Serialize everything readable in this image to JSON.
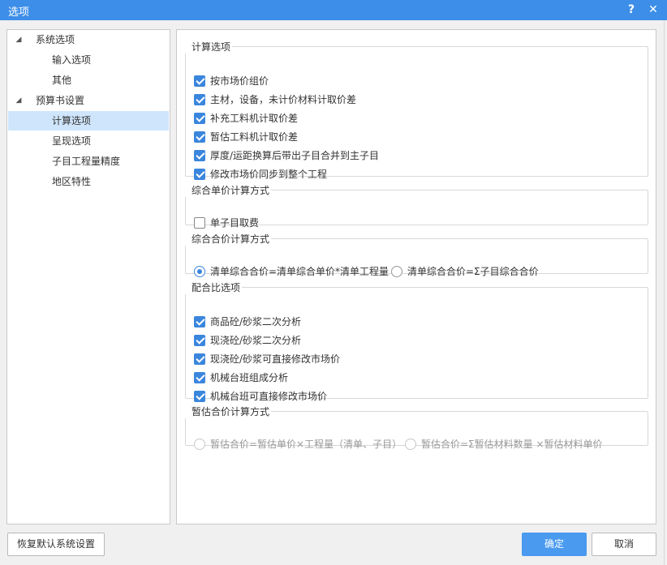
{
  "window": {
    "title": "选项",
    "help_glyph": "?",
    "close_glyph": "✕"
  },
  "tree": {
    "items": [
      {
        "label": "系统选项",
        "level": 1,
        "expanded": true
      },
      {
        "label": "输入选项",
        "level": 2
      },
      {
        "label": "其他",
        "level": 2
      },
      {
        "label": "预算书设置",
        "level": 1,
        "expanded": true
      },
      {
        "label": "计算选项",
        "level": 2,
        "selected": true
      },
      {
        "label": "呈现选项",
        "level": 2
      },
      {
        "label": "子目工程量精度",
        "level": 2
      },
      {
        "label": "地区特性",
        "level": 2
      }
    ],
    "expanded_glyph": "◢"
  },
  "groups": {
    "calc": {
      "title": "计算选项",
      "options": [
        {
          "label": "按市场价组价",
          "checked": true
        },
        {
          "label": "主材，设备，未计价材料计取价差",
          "checked": true
        },
        {
          "label": "补充工料机计取价差",
          "checked": true
        },
        {
          "label": "暂估工料机计取价差",
          "checked": true
        },
        {
          "label": "厚度/运距换算后带出子目合并到主子目",
          "checked": true
        },
        {
          "label": "修改市场价同步到整个工程",
          "checked": true
        }
      ]
    },
    "unit_price": {
      "title": "综合单价计算方式",
      "options": [
        {
          "label": "单子目取费",
          "checked": false
        }
      ]
    },
    "total_price": {
      "title": "综合合价计算方式",
      "radios": [
        {
          "label": "清单综合合价=清单综合单价*清单工程量",
          "selected": true
        },
        {
          "label": "清单综合合价=Σ子目综合合价",
          "selected": false
        }
      ]
    },
    "mix": {
      "title": "配合比选项",
      "options": [
        {
          "label": "商品砼/砂浆二次分析",
          "checked": true
        },
        {
          "label": "现浇砼/砂浆二次分析",
          "checked": true
        },
        {
          "label": "现浇砼/砂浆可直接修改市场价",
          "checked": true
        },
        {
          "label": "机械台班组成分析",
          "checked": true
        },
        {
          "label": "机械台班可直接修改市场价",
          "checked": true
        }
      ]
    },
    "provisional": {
      "title": "暂估合价计算方式",
      "disabled": true,
      "radios": [
        {
          "label": "暂估合价=暂估单价×工程量（清单、子目）",
          "selected": false
        },
        {
          "label": "暂估合价=Σ暂估材料数量 ×暂估材料单价",
          "selected": false
        }
      ]
    }
  },
  "buttons": {
    "restore": "恢复默认系统设置",
    "ok": "确定",
    "cancel": "取消"
  },
  "colors": {
    "titlebar": "#3d8ee8",
    "accent": "#3b86dd",
    "selected_row": "#cfe5fb",
    "primary_button": "#4a9af0"
  }
}
